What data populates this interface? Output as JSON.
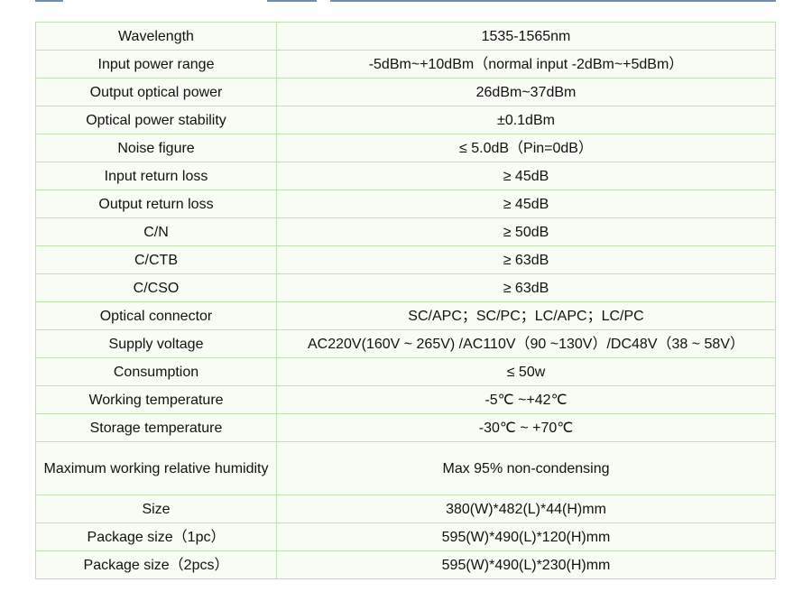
{
  "colors": {
    "border": "#bfe0b0",
    "cell_bg": "#f8fcf4",
    "top_bar": "#6f8fb0",
    "text": "#111111"
  },
  "spec_table": {
    "rows": [
      {
        "param": "Wavelength",
        "value": "1535-1565nm"
      },
      {
        "param": "Input power range",
        "value": "-5dBm~+10dBm（normal input -2dBm~+5dBm）"
      },
      {
        "param": "Output optical power",
        "value": "26dBm~37dBm"
      },
      {
        "param": "Optical power stability",
        "value": "±0.1dBm"
      },
      {
        "param": "Noise figure",
        "value": "≤ 5.0dB（Pin=0dB）"
      },
      {
        "param": "Input return loss",
        "value": "≥ 45dB"
      },
      {
        "param": "Output return loss",
        "value": "≥ 45dB"
      },
      {
        "param": "C/N",
        "value": "≥ 50dB"
      },
      {
        "param": "C/CTB",
        "value": "≥ 63dB"
      },
      {
        "param": "C/CSO",
        "value": "≥ 63dB"
      },
      {
        "param": "Optical connector",
        "value": "SC/APC；SC/PC；LC/APC；LC/PC"
      },
      {
        "param": "Supply voltage",
        "value": "AC220V(160V ~ 265V) /AC110V（90 ~130V）/DC48V（38 ~ 58V）"
      },
      {
        "param": "Consumption",
        "value": "≤ 50w"
      },
      {
        "param": "Working temperature",
        "value": "-5℃ ~+42℃"
      },
      {
        "param": "Storage temperature",
        "value": "-30℃ ~ +70℃"
      },
      {
        "param": "Maximum working relative humidity",
        "value": "Max 95% non-condensing"
      },
      {
        "param": "Size",
        "value": "380(W)*482(L)*44(H)mm"
      },
      {
        "param": "Package size（1pc）",
        "value": "595(W)*490(L)*120(H)mm"
      },
      {
        "param": "Package size（2pcs）",
        "value": "595(W)*490(L)*230(H)mm"
      }
    ]
  }
}
